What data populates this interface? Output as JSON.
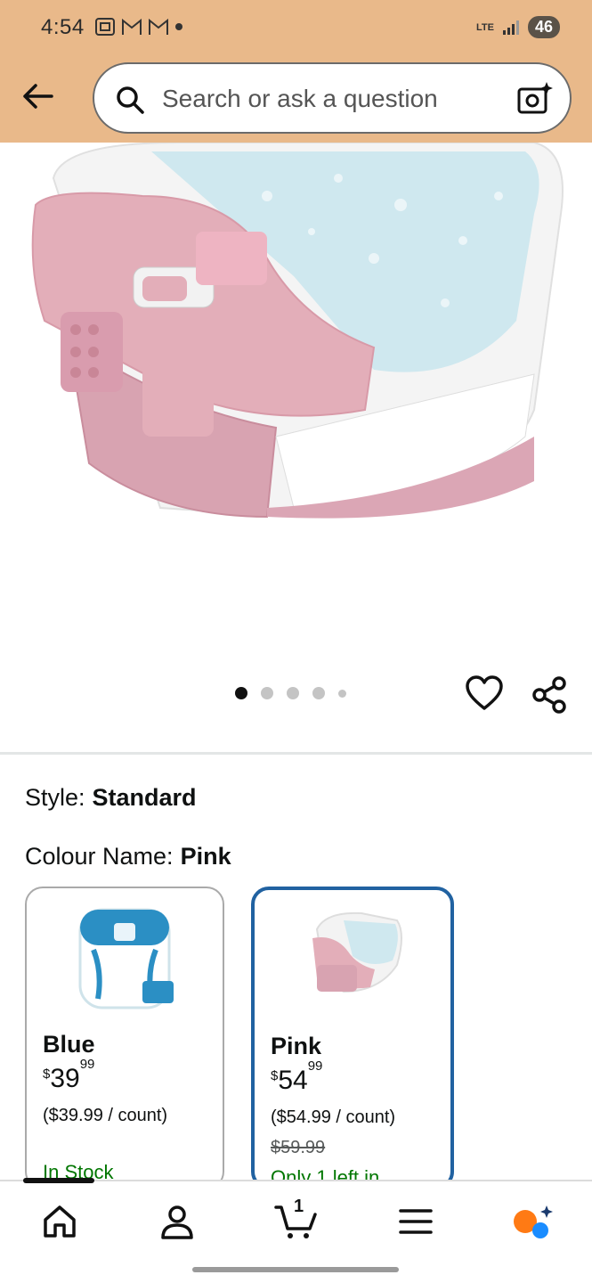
{
  "status_bar": {
    "time": "4:54",
    "network": "LTE",
    "battery": "46"
  },
  "header": {
    "search_placeholder": "Search or ask a question"
  },
  "carousel": {
    "image_count": 5,
    "active_index": 0
  },
  "product": {
    "style_label": "Style:",
    "style_value": "Standard",
    "colour_label": "Colour Name:",
    "colour_value": "Pink"
  },
  "variants": [
    {
      "name": "Blue",
      "price_symbol": "$",
      "price_whole": "39",
      "price_fraction": "99",
      "unit_price": "($39.99 / count)",
      "was_price": "",
      "stock": "In Stock",
      "selected": false
    },
    {
      "name": "Pink",
      "price_symbol": "$",
      "price_whole": "54",
      "price_fraction": "99",
      "unit_price": "($54.99 / count)",
      "was_price": "$59.99",
      "stock": "Only 1 left in",
      "selected": true
    }
  ],
  "bottom_nav": {
    "cart_count": "1"
  },
  "colors": {
    "header_bg": "#e9b98a",
    "accent_blue": "#2162a1",
    "stock_green": "#007600"
  }
}
